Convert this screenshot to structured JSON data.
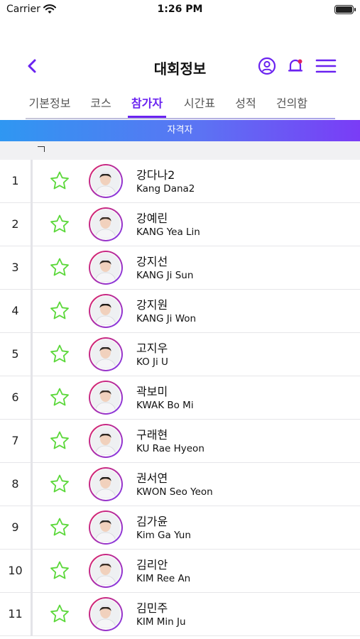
{
  "status_bar": {
    "carrier": "Carrier",
    "time": "1:26 PM",
    "battery_level": 1.0
  },
  "nav": {
    "title": "대회정보",
    "back_icon": "chevron-left-icon",
    "profile_icon": "user-circle-icon",
    "notification_icon": "bell-icon",
    "menu_icon": "hamburger-menu-icon",
    "accent_color": "#6a22f0"
  },
  "tabs": [
    {
      "label": "기본정보",
      "active": false
    },
    {
      "label": "코스",
      "active": false
    },
    {
      "label": "참가자",
      "active": true
    },
    {
      "label": "시간표",
      "active": false
    },
    {
      "label": "성적",
      "active": false
    },
    {
      "label": "건의함",
      "active": false
    }
  ],
  "banner": {
    "label": "자격자"
  },
  "players": [
    {
      "rank": "1",
      "name_ko": "강다나2",
      "name_en": "Kang Dana2",
      "favorite": false
    },
    {
      "rank": "2",
      "name_ko": "강예린",
      "name_en": "KANG Yea Lin",
      "favorite": false
    },
    {
      "rank": "3",
      "name_ko": "강지선",
      "name_en": "KANG Ji Sun",
      "favorite": false
    },
    {
      "rank": "4",
      "name_ko": "강지원",
      "name_en": "KANG Ji Won",
      "favorite": false
    },
    {
      "rank": "5",
      "name_ko": "고지우",
      "name_en": "KO Ji U",
      "favorite": false
    },
    {
      "rank": "6",
      "name_ko": "곽보미",
      "name_en": "KWAK Bo Mi",
      "favorite": false
    },
    {
      "rank": "7",
      "name_ko": "구래현",
      "name_en": "KU Rae Hyeon",
      "favorite": false
    },
    {
      "rank": "8",
      "name_ko": "권서연",
      "name_en": "KWON Seo Yeon",
      "favorite": false
    },
    {
      "rank": "9",
      "name_ko": "김가윤",
      "name_en": "Kim Ga Yun",
      "favorite": false
    },
    {
      "rank": "10",
      "name_ko": "김리안",
      "name_en": "KIM Ree An",
      "favorite": false
    },
    {
      "rank": "11",
      "name_ko": "김민주",
      "name_en": "KIM Min Ju",
      "favorite": false
    }
  ],
  "colors": {
    "star_outline": "#5bd83a",
    "avatar_ring_start": "#e02560",
    "avatar_ring_end": "#7d3bf0"
  }
}
